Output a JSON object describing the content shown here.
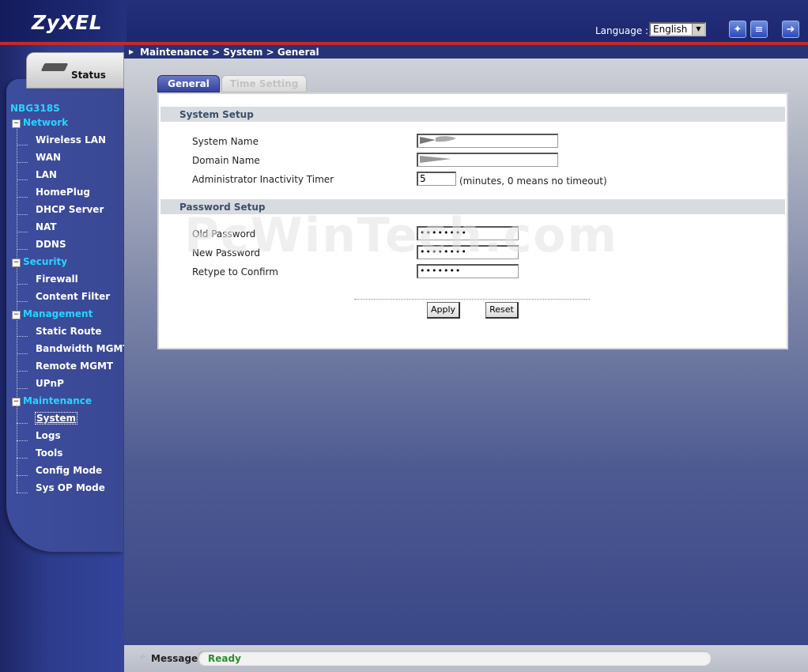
{
  "header": {
    "brand": "ZyXEL",
    "language_label": "Language :",
    "language_value": "English",
    "icons": [
      "wizard-icon",
      "help-icon",
      "logout-icon"
    ]
  },
  "breadcrumb": "Maintenance > System > General",
  "sidebar": {
    "status_label": "Status",
    "device_name": "NBG318S",
    "categories": [
      {
        "label": "Network",
        "items": [
          "Wireless LAN",
          "WAN",
          "LAN",
          "HomePlug",
          "DHCP Server",
          "NAT",
          "DDNS"
        ]
      },
      {
        "label": "Security",
        "items": [
          "Firewall",
          "Content Filter"
        ]
      },
      {
        "label": "Management",
        "items": [
          "Static Route",
          "Bandwidth MGMT",
          "Remote MGMT",
          "UPnP"
        ]
      },
      {
        "label": "Maintenance",
        "items": [
          "System",
          "Logs",
          "Tools",
          "Config Mode",
          "Sys OP Mode"
        ]
      }
    ],
    "selected": "System"
  },
  "tabs": [
    {
      "label": "General",
      "active": true
    },
    {
      "label": "Time Setting",
      "active": false
    }
  ],
  "system_setup": {
    "title": "System Setup",
    "system_name_label": "System Name",
    "domain_name_label": "Domain Name",
    "timer_label": "Administrator Inactivity Timer",
    "timer_value": "5",
    "timer_hint": "(minutes, 0 means no timeout)"
  },
  "password_setup": {
    "title": "Password Setup",
    "old_label": "Old Password",
    "new_label": "New Password",
    "retype_label": "Retype to Confirm",
    "old_value": "••••••••",
    "new_value": "••••••••",
    "retype_value": "•••••••"
  },
  "buttons": {
    "apply": "Apply",
    "reset": "Reset"
  },
  "watermark": "PcWinTech.com",
  "message": {
    "label": "Message",
    "text": "Ready"
  },
  "colors": {
    "accent_blue": "#2a3775",
    "header_red": "#c12a2a",
    "nav_cyan": "#28d4ff",
    "ready_green": "#2e8b2e"
  }
}
